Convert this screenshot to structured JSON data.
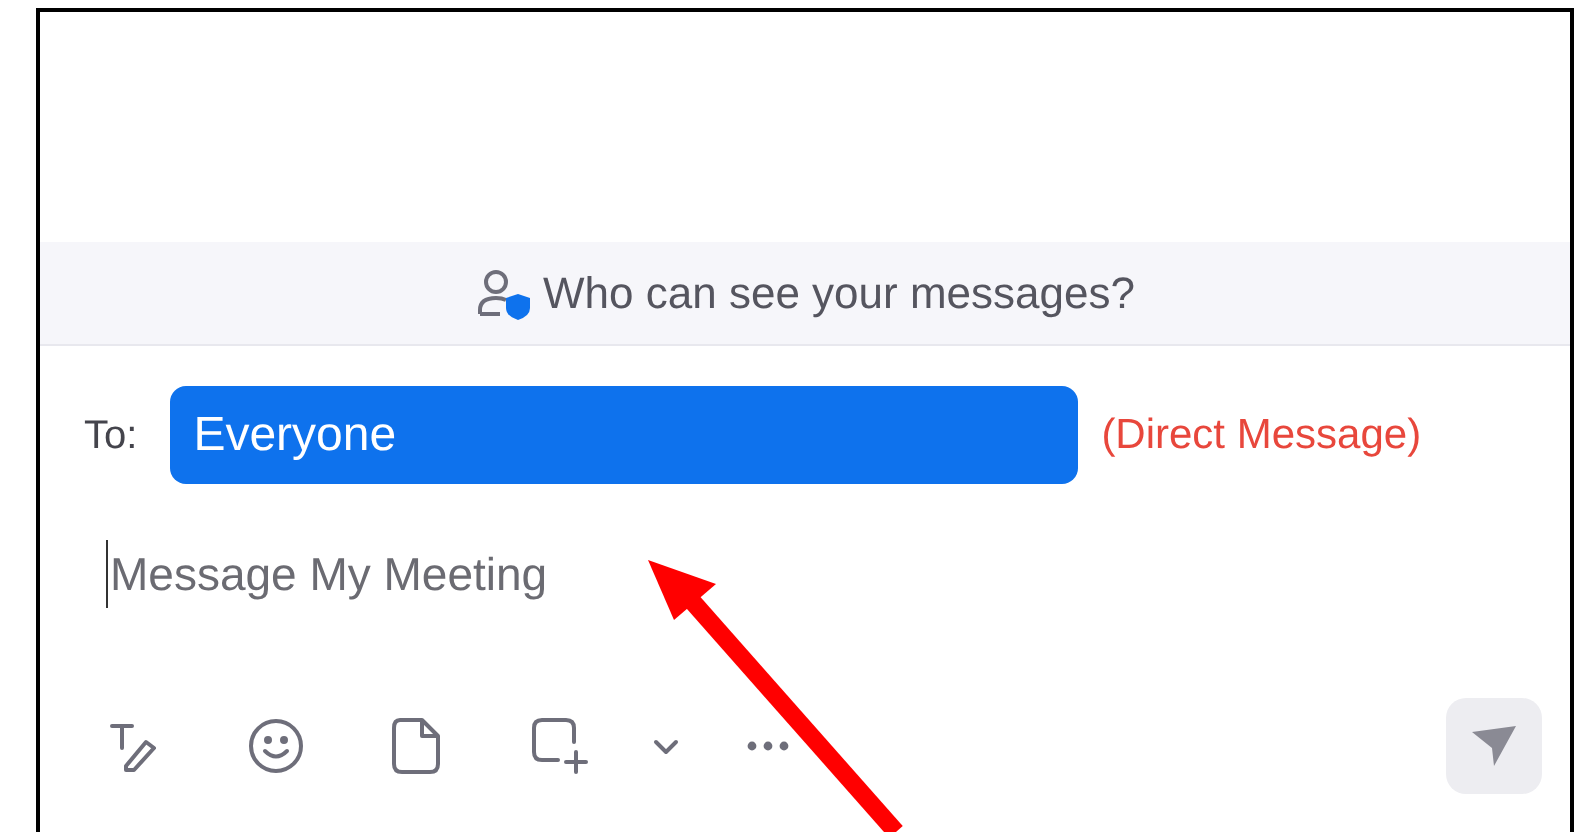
{
  "privacy_banner": {
    "text": "Who can see your messages?"
  },
  "recipient": {
    "label": "To:",
    "value": "Everyone",
    "note": "(Direct Message)"
  },
  "message": {
    "placeholder": "Message My Meeting"
  }
}
